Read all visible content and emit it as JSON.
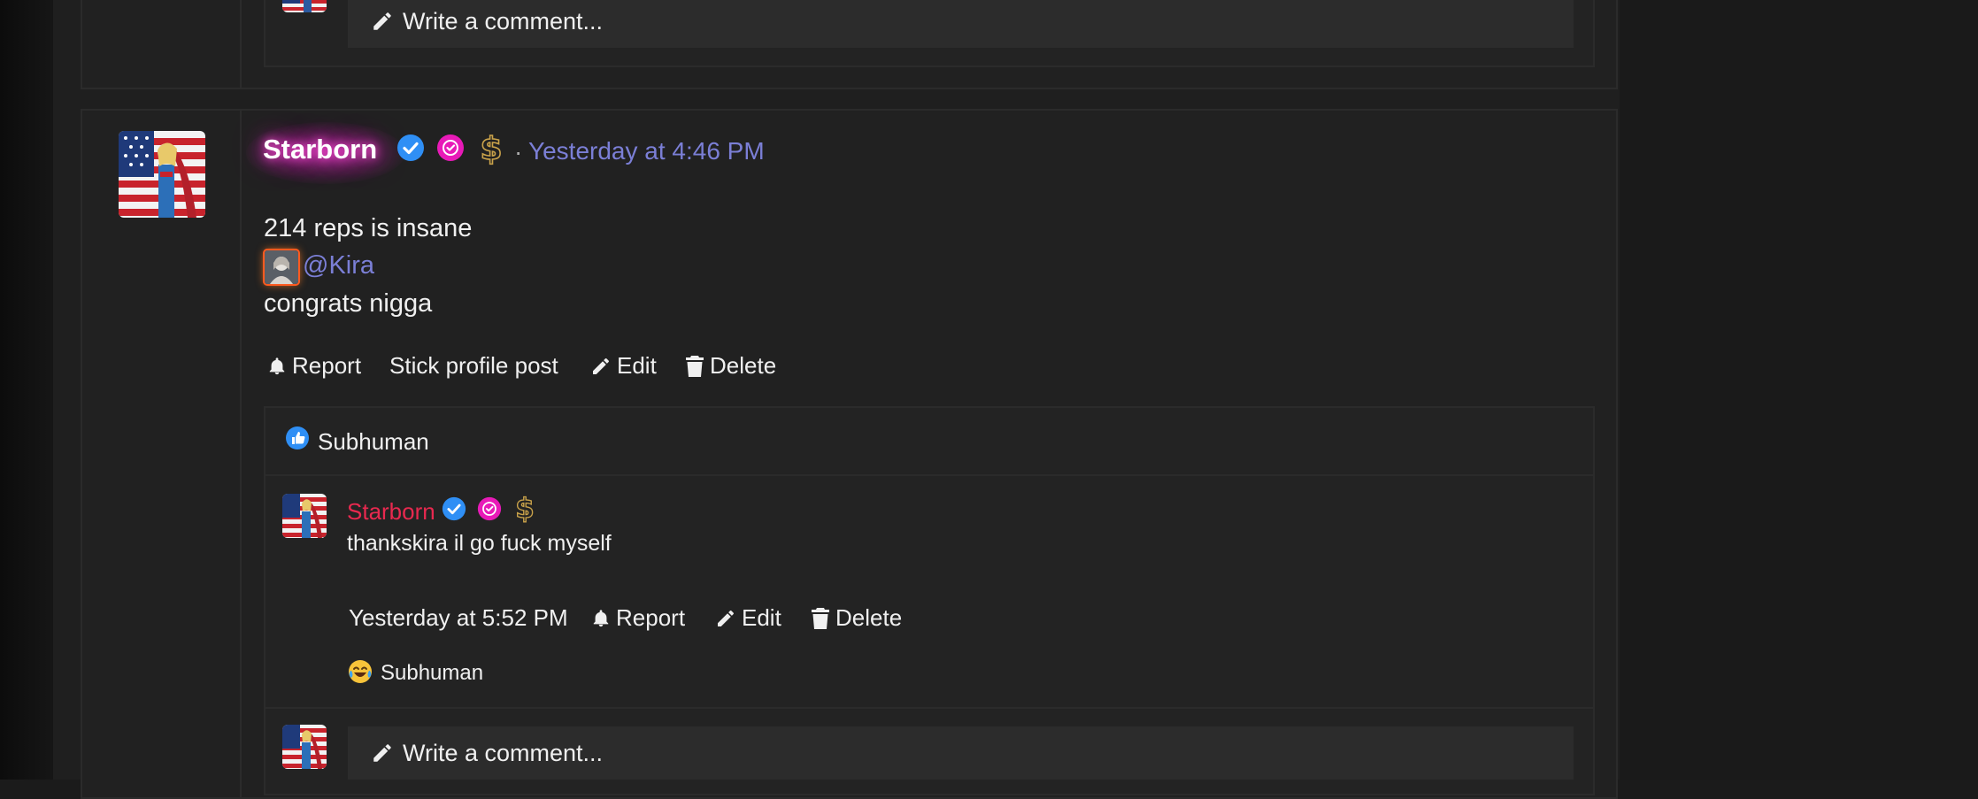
{
  "post": {
    "username": "Starborn",
    "separator": "·",
    "timestamp": "Yesterday at 4:46 PM",
    "lines": [
      "214 reps is insane",
      "congrats nigga"
    ],
    "mention": "@Kira",
    "actions": {
      "report": "Report",
      "stick": "Stick profile post",
      "edit": "Edit",
      "delete": "Delete"
    },
    "reaction_user": "Subhuman"
  },
  "comment": {
    "username": "Starborn",
    "text": "thankskira il go fuck myself",
    "timestamp": "Yesterday at 5:52 PM",
    "actions": {
      "report": "Report",
      "edit": "Edit",
      "delete": "Delete"
    },
    "reaction_user": "Subhuman"
  },
  "write_comment": {
    "placeholder": "Write a comment..."
  },
  "colors": {
    "link": "#7b7fd6",
    "comment_username": "#e8294f",
    "verified_blue": "#2f8ff5",
    "badge_pink": "#e81ab8",
    "dollar_gold": "#c9a24a"
  },
  "icons": [
    "verified-badge-icon",
    "pink-check-badge-icon",
    "dollar-sign-icon",
    "bell-icon",
    "pencil-icon",
    "trash-icon",
    "like-reaction-icon",
    "laugh-cry-reaction-icon"
  ]
}
